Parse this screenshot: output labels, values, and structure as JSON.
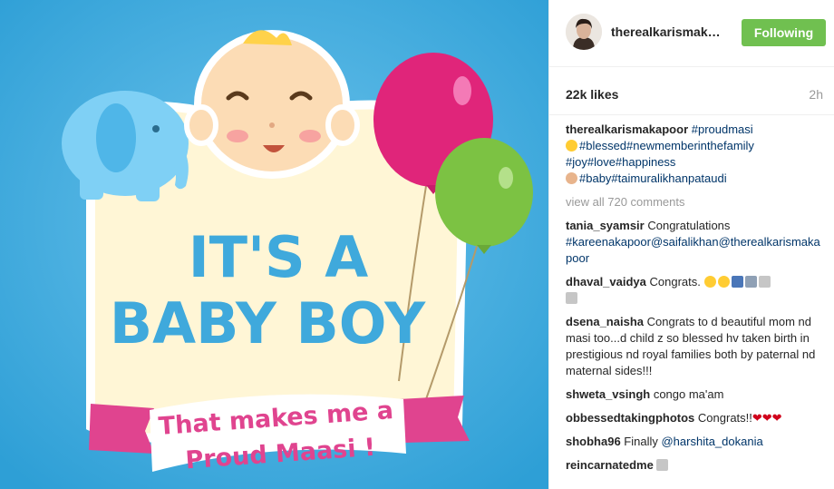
{
  "post": {
    "headline_1": "IT'S A",
    "headline_2": "BABY BOY",
    "ribbon_line_1": "That makes me a",
    "ribbon_line_2": "Proud Maasi !"
  },
  "header": {
    "username": "therealkarismak…",
    "follow_label": "Following"
  },
  "stats": {
    "likes": "22k likes",
    "time": "2h"
  },
  "caption": {
    "user": "therealkarismakapoor",
    "line1_tag": "#proudmasi",
    "line2": "#blessed#newmemberinthefamily",
    "line3": "#joy#love#happiness",
    "line4": "#baby#taimuralikhanpataudi"
  },
  "view_all": "view all 720 comments",
  "comments": [
    {
      "user": "tania_syamsir",
      "text": " Congratulations",
      "tags": "#kareenakapoor@saifalikhan@therealkarismakapoor"
    },
    {
      "user": "dhaval_vaidya",
      "text": " Congrats."
    },
    {
      "user": "dsena_naisha",
      "text": " Congrats to d beautiful mom nd masi too...d child z so blessed hv taken birth in prestigious nd royal families both by paternal nd maternal sides!!!"
    },
    {
      "user": "shweta_vsingh",
      "text": " congo ma'am"
    },
    {
      "user": "obbessedtakingphotos",
      "text": " Congrats!!"
    },
    {
      "user": "shobha96",
      "text": " Finally ",
      "tags": "@harshita_dokania"
    },
    {
      "user": "reincarnatedme",
      "text": ""
    }
  ],
  "colors": {
    "background": "#3fa9dc",
    "follow_button": "#70c050",
    "hashtag": "#003569",
    "headline": "#3fa9dc",
    "ribbon_text": "#e0448f"
  }
}
